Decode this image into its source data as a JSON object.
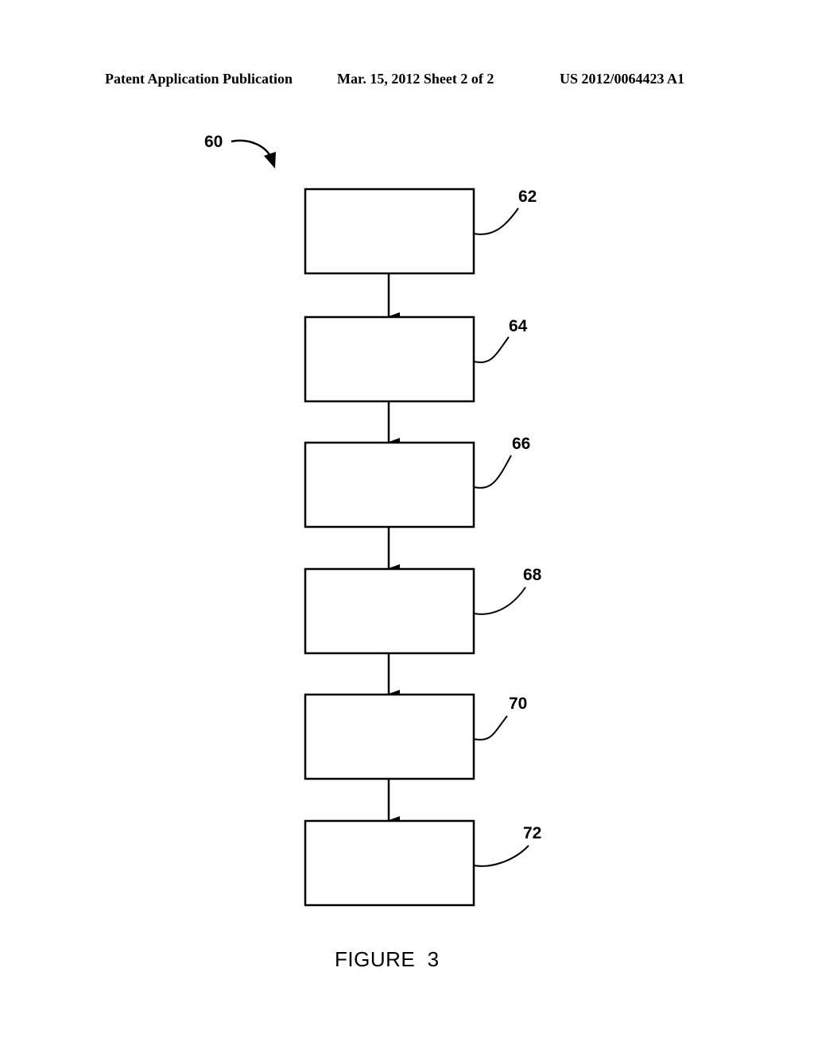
{
  "header": {
    "publication": "Patent Application Publication",
    "date_sheet": "Mar. 15, 2012  Sheet 2 of 2",
    "number": "US 2012/0064423 A1"
  },
  "figure": {
    "reference": "60",
    "caption": "FIGURE  3",
    "steps": [
      {
        "ref": "62"
      },
      {
        "ref": "64"
      },
      {
        "ref": "66"
      },
      {
        "ref": "68"
      },
      {
        "ref": "70"
      },
      {
        "ref": "72"
      }
    ],
    "flow_direction": "top-to-bottom"
  }
}
